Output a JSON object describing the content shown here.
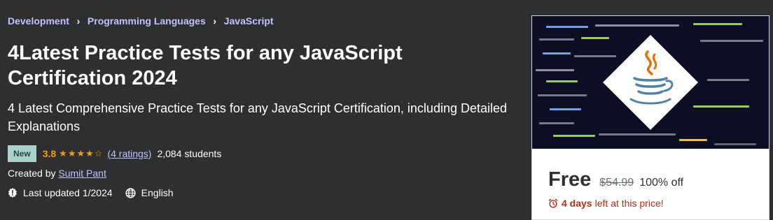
{
  "breadcrumb": [
    "Development",
    "Programming Languages",
    "JavaScript"
  ],
  "course": {
    "title": "4Latest Practice Tests for any JavaScript Certification 2024",
    "subtitle": "4 Latest Comprehensive Practice Tests for any JavaScript Certification, including Detailed Explanations",
    "badge": "New",
    "rating": "3.8",
    "rating_stars": 3.8,
    "ratings_count": "(4 ratings)",
    "students": "2,084 students",
    "created_by_label": "Created by",
    "instructor": "Sumit Pant",
    "last_updated": "Last updated 1/2024",
    "language": "English"
  },
  "card": {
    "price": "Free",
    "original_price": "$54.99",
    "discount": "100% off",
    "deadline_bold": "4 days",
    "deadline_rest": "left at this price!",
    "thumbnail_icon": "java-coffee-cup-icon"
  },
  "colors": {
    "background": "#2d2f31",
    "link": "#c0c4fc",
    "rating": "#f69c08",
    "badge_bg": "#acd2cc",
    "badge_text": "#1d4e47",
    "deadline": "#b32d0f"
  },
  "icons": [
    "chevron-right-icon",
    "star-icon",
    "alert-badge-icon",
    "globe-icon",
    "alarm-clock-icon"
  ]
}
